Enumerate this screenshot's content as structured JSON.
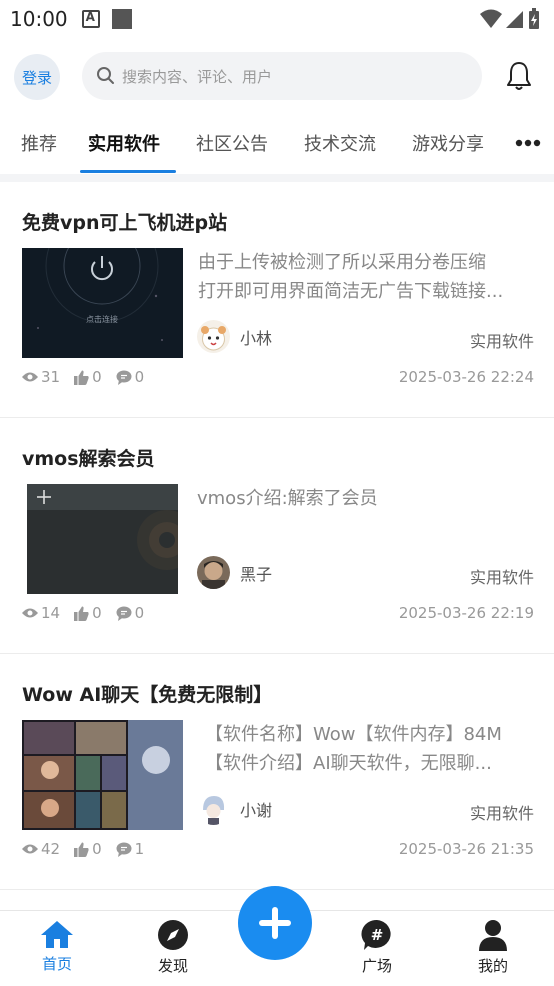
{
  "status_bar": {
    "time": "10:00"
  },
  "header": {
    "login_label": "登录",
    "search_placeholder": "搜索内容、评论、用户"
  },
  "tabs": [
    {
      "label": "推荐"
    },
    {
      "label": "实用软件",
      "active": true
    },
    {
      "label": "社区公告"
    },
    {
      "label": "技术交流"
    },
    {
      "label": "游戏分享"
    }
  ],
  "posts": [
    {
      "title": "免费vpn可上飞机进p站",
      "thumb_caption": "点击连接",
      "excerpt": [
        "由于上传被检测了所以采用分卷压缩",
        "打开即可用界面简洁无广告下载链接..."
      ],
      "author": "小林",
      "category": "实用软件",
      "views": "31",
      "likes": "0",
      "comments": "0",
      "time": "2025-03-26 22:24"
    },
    {
      "title": "vmos解索会员",
      "excerpt": [
        "vmos介绍:解索了会员"
      ],
      "author": "黑子",
      "category": "实用软件",
      "views": "14",
      "likes": "0",
      "comments": "0",
      "time": "2025-03-26 22:19"
    },
    {
      "title": "Wow AI聊天【免费无限制】",
      "excerpt": [
        "【软件名称】Wow【软件内存】84M",
        "【软件介绍】AI聊天软件，无限聊..."
      ],
      "author": "小谢",
      "category": "实用软件",
      "views": "42",
      "likes": "0",
      "comments": "1",
      "time": "2025-03-26 21:35"
    }
  ],
  "bottom_nav": [
    {
      "label": "首页",
      "icon": "home-icon",
      "active": true
    },
    {
      "label": "发现",
      "icon": "compass-icon"
    },
    {
      "label": "广场",
      "icon": "hashtag-icon"
    },
    {
      "label": "我的",
      "icon": "user-icon"
    }
  ],
  "colors": {
    "accent": "#1a7fe0",
    "fab": "#1a8cf0"
  }
}
